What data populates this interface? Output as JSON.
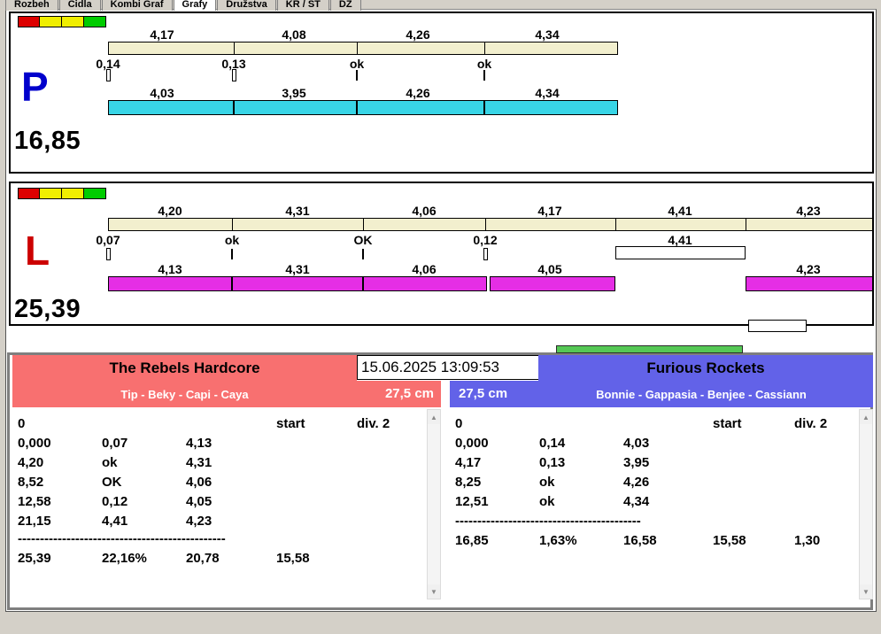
{
  "tabs": {
    "items": [
      "Rozbeh",
      "Cidla",
      "Kombi Graf",
      "Grafy",
      "Družstva",
      "KR / ST",
      "DZ"
    ],
    "selected": "Grafy"
  },
  "legend_colors": [
    "#dd0000",
    "#f0ee00",
    "#f0ee00",
    "#00cc00"
  ],
  "panel_p": {
    "letter": "P",
    "total": "16,85",
    "top_values": [
      "4,17",
      "4,08",
      "4,26",
      "4,34"
    ],
    "mid_values": [
      "0,14",
      "0,13",
      "ok",
      "ok"
    ],
    "bottom_values": [
      "4,03",
      "3,95",
      "4,26",
      "4,34"
    ],
    "colors": {
      "letter": "#0000cc",
      "bar_top": "#f2efce",
      "bar_bottom": "#38d5e6"
    }
  },
  "panel_l": {
    "letter": "L",
    "total": "25,39",
    "top_values": [
      "4,20",
      "4,31",
      "4,06",
      "4,17",
      "4,41",
      "4,23"
    ],
    "mid_values": [
      "0,07",
      "ok",
      "OK",
      "0,12",
      "4,41"
    ],
    "bottom_values": [
      "4,13",
      "4,31",
      "4,06",
      "4,05",
      "4,23"
    ],
    "colors": {
      "letter": "#cc0000",
      "bar_top": "#f2efce",
      "bar_bottom": "#e52ee5"
    }
  },
  "misc": {
    "green_strip_color": "#55c855"
  },
  "icons": {
    "scroll_up": "▲",
    "scroll_down": "▼"
  },
  "scoreboard": {
    "datetime": "15.06.2025 13:09:53",
    "left": {
      "color": "#f87070",
      "team": "The Rebels Hardcore",
      "members": "Tip - Beky - Capi - Caya",
      "category": "27,5 cm",
      "header": [
        "0",
        "",
        "",
        "start",
        "div. 2"
      ],
      "rows": [
        [
          "0,000",
          "0,07",
          "4,13",
          "",
          ""
        ],
        [
          "4,20",
          "ok",
          "4,31",
          "",
          ""
        ],
        [
          "8,52",
          "OK",
          "4,06",
          "",
          ""
        ],
        [
          "12,58",
          "0,12",
          "4,05",
          "",
          ""
        ],
        [
          "21,15",
          "4,41",
          "4,23",
          "",
          ""
        ]
      ],
      "separator": "-----------------------------------------------",
      "totals": [
        "25,39",
        "22,16%",
        "20,78",
        "15,58",
        ""
      ]
    },
    "right": {
      "color": "#6262e8",
      "team": "Furious Rockets",
      "members": "Bonnie - Gappasia - Benjee - Cassiann",
      "category": "27,5 cm",
      "header": [
        "0",
        "",
        "",
        "start",
        "div. 2"
      ],
      "rows": [
        [
          "0,000",
          "0,14",
          "4,03",
          "",
          ""
        ],
        [
          "4,17",
          "0,13",
          "3,95",
          "",
          ""
        ],
        [
          "8,25",
          "ok",
          "4,26",
          "",
          ""
        ],
        [
          "12,51",
          "ok",
          "4,34",
          "",
          ""
        ]
      ],
      "separator": "------------------------------------------",
      "totals": [
        "16,85",
        "1,63%",
        "16,58",
        "15,58",
        "1,30"
      ]
    }
  }
}
